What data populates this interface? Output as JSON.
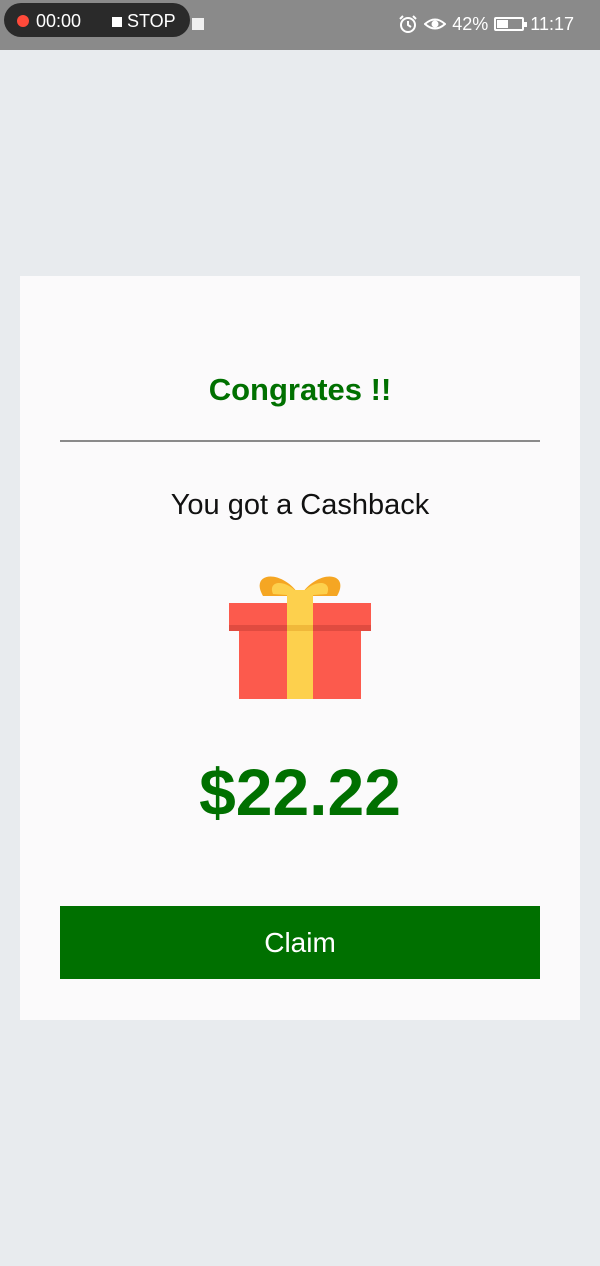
{
  "status_bar": {
    "recording_time": "00:00",
    "stop_label": "STOP",
    "battery_percent": "42%",
    "clock": "11:17",
    "icons": [
      "alarm-icon",
      "eye-icon",
      "battery-icon"
    ]
  },
  "dialog": {
    "title": "Congrates !!",
    "subtitle": "You got a Cashback",
    "amount": "$22.22",
    "claim_label": "Claim",
    "gift_icon": "gift-icon"
  },
  "colors": {
    "accent": "#007000",
    "background": "#e8ebee",
    "card": "#fbfafb",
    "status_bar": "#8a8a8a",
    "gift_box": "#fc5a4d",
    "gift_ribbon": "#fdd04d"
  }
}
